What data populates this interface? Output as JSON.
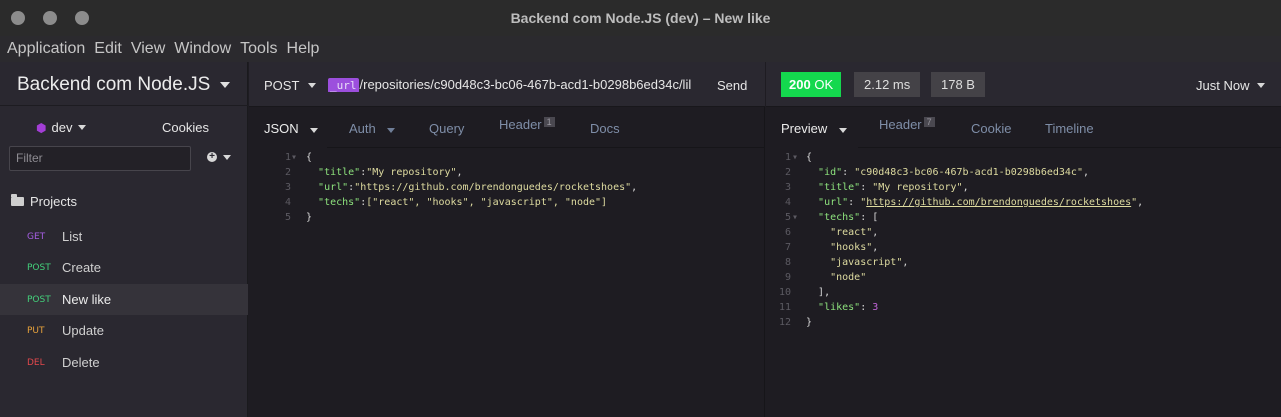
{
  "window": {
    "title": "Backend com Node.JS (dev) – New like"
  },
  "menu": [
    "Application",
    "Edit",
    "View",
    "Window",
    "Tools",
    "Help"
  ],
  "sidebar": {
    "workspace": "Backend com Node.JS",
    "environment": "dev",
    "cookies_label": "Cookies",
    "filter_placeholder": "Filter",
    "projects_label": "Projects",
    "requests": [
      {
        "method": "GET",
        "name": "List",
        "color": "#a55ee3"
      },
      {
        "method": "POST",
        "name": "Create",
        "color": "#43d17b"
      },
      {
        "method": "POST",
        "name": "New like",
        "color": "#43d17b"
      },
      {
        "method": "PUT",
        "name": "Update",
        "color": "#e8a23b"
      },
      {
        "method": "DEL",
        "name": "Delete",
        "color": "#e2484c"
      }
    ]
  },
  "request": {
    "method": "POST",
    "url_tag": "_url",
    "url_path": "/repositories/c90d48c3-bc06-467b-acd1-b0298b6ed34c/lil",
    "send_label": "Send",
    "tabs": {
      "json": "JSON",
      "auth": "Auth",
      "query": "Query",
      "header": "Header",
      "header_count": "1",
      "docs": "Docs"
    },
    "body": {
      "title_key": "\"title\"",
      "title_val": "\"My repository\"",
      "url_key": "\"url\"",
      "url_val": "\"https://github.com/brendonguedes/rocketshoes\"",
      "techs_key": "\"techs\"",
      "techs_val": "[\"react\", \"hooks\", \"javascript\", \"node\"]"
    }
  },
  "response": {
    "status_code": "200",
    "status_text": "OK",
    "time": "2.12 ms",
    "size": "178 B",
    "when": "Just Now",
    "tabs": {
      "preview": "Preview",
      "header": "Header",
      "header_count": "7",
      "cookie": "Cookie",
      "timeline": "Timeline"
    },
    "body": {
      "id_key": "\"id\"",
      "id_val": "\"c90d48c3-bc06-467b-acd1-b0298b6ed34c\"",
      "title_key": "\"title\"",
      "title_val": "\"My repository\"",
      "url_key": "\"url\"",
      "url_val_pre": "\"",
      "url_val_link": "https://github.com/brendonguedes/rocketshoes",
      "url_val_post": "\"",
      "techs_key": "\"techs\"",
      "tech_1": "\"react\"",
      "tech_2": "\"hooks\"",
      "tech_3": "\"javascript\"",
      "tech_4": "\"node\"",
      "likes_key": "\"likes\"",
      "likes_val": "3"
    }
  },
  "colors": {
    "accent": "#9c4fdd",
    "status_ok": "#14d84e",
    "json_key": "#8de27d",
    "json_string": "#dedba0",
    "json_number": "#c064d7"
  }
}
